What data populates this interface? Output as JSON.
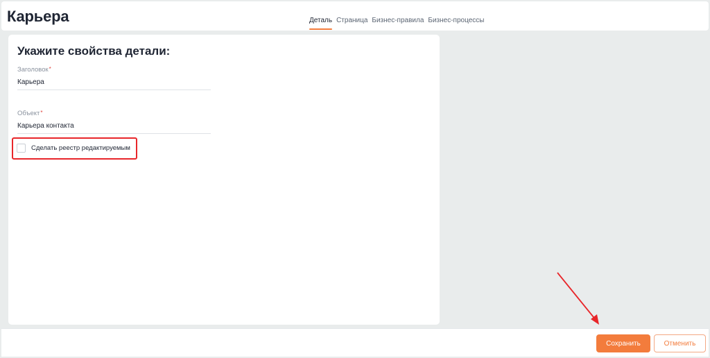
{
  "header": {
    "title": "Карьера",
    "tabs": [
      {
        "label": "Деталь",
        "active": true
      },
      {
        "label": "Страница",
        "active": false
      },
      {
        "label": "Бизнес-правила",
        "active": false
      },
      {
        "label": "Бизнес-процессы",
        "active": false
      }
    ]
  },
  "panel": {
    "title": "Укажите свойства детали:",
    "fields": [
      {
        "label": "Заголовок",
        "required_mark": "*",
        "value": "Карьера"
      },
      {
        "label": "Объект",
        "required_mark": "*",
        "value": "Карьера контакта"
      }
    ],
    "checkbox": {
      "label": "Сделать реестр редактируемым",
      "checked": false
    }
  },
  "footer": {
    "save_label": "Сохранить",
    "cancel_label": "Отменить"
  },
  "colors": {
    "accent": "#f37c3c",
    "annotation": "#e8262a",
    "background": "#e9ecec"
  }
}
